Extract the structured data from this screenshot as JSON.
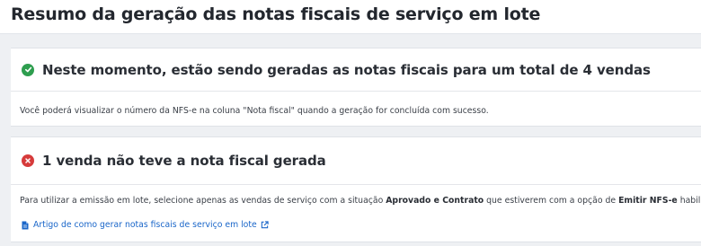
{
  "page": {
    "title": "Resumo da geração das notas fiscais de serviço em lote"
  },
  "success_card": {
    "icon": "check-circle-icon",
    "icon_color": "#2e9e4f",
    "title": "Neste momento, estão sendo geradas as notas fiscais para um total de 4 vendas",
    "message": "Você poderá visualizar o número da NFS-e na coluna \"Nota fiscal\" quando a geração for concluída com sucesso."
  },
  "error_card": {
    "icon": "error-circle-icon",
    "icon_color": "#d63b3b",
    "title": "1 venda não teve a nota fiscal gerada",
    "message_parts": {
      "p1": "Para utilizar a emissão em lote, selecione apenas as vendas de serviço com a situação ",
      "b1": "Aprovado e Contrato",
      "p2": " que estiverem com a opção de ",
      "b2": "Emitir NFS-e",
      "p3": " habilitada."
    },
    "link": {
      "label": "Artigo de como gerar notas fiscais de serviço em lote",
      "color": "#1a66c9",
      "icon": "document-icon",
      "trailing_icon": "external-link-icon"
    }
  }
}
